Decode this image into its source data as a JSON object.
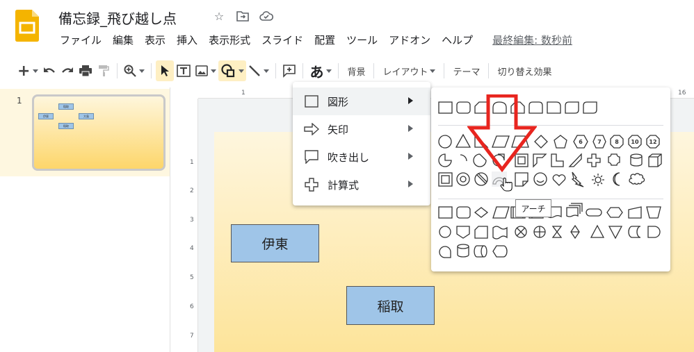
{
  "header": {
    "title": "備忘録_飛び越し点",
    "last_edit": "最終編集: 数秒前"
  },
  "menubar": [
    "ファイル",
    "編集",
    "表示",
    "挿入",
    "表示形式",
    "スライド",
    "配置",
    "ツール",
    "アドオン",
    "ヘルプ"
  ],
  "toolbar": {
    "bg_label": "背景",
    "layout_label": "レイアウト",
    "theme_label": "テーマ",
    "transition_label": "切り替え効果",
    "text_glyph": "あ"
  },
  "filmstrip": {
    "slide_number": "1",
    "mini_labels": [
      "稲取",
      "伊東",
      "大島",
      "稲取"
    ]
  },
  "ruler": {
    "top": [
      "1",
      "16"
    ],
    "left": [
      "1",
      "2",
      "3",
      "4",
      "5",
      "6",
      "7"
    ]
  },
  "slide": {
    "boxes": [
      "伊東",
      "稲取"
    ]
  },
  "shape_menu": {
    "items": [
      {
        "label": "図形",
        "icon": "square-outline-icon"
      },
      {
        "label": "矢印",
        "icon": "arrow-outline-icon"
      },
      {
        "label": "吹き出し",
        "icon": "callout-icon"
      },
      {
        "label": "計算式",
        "icon": "plus-outline-icon"
      }
    ]
  },
  "palette": {
    "numbered": [
      "6",
      "7",
      "8",
      "10",
      "12"
    ]
  },
  "tooltip": "アーチ",
  "colors": {
    "accent": "#feefc3",
    "box_fill": "#9fc5e8",
    "annotation_red": "#e8251f",
    "logo": "#f4b400"
  }
}
